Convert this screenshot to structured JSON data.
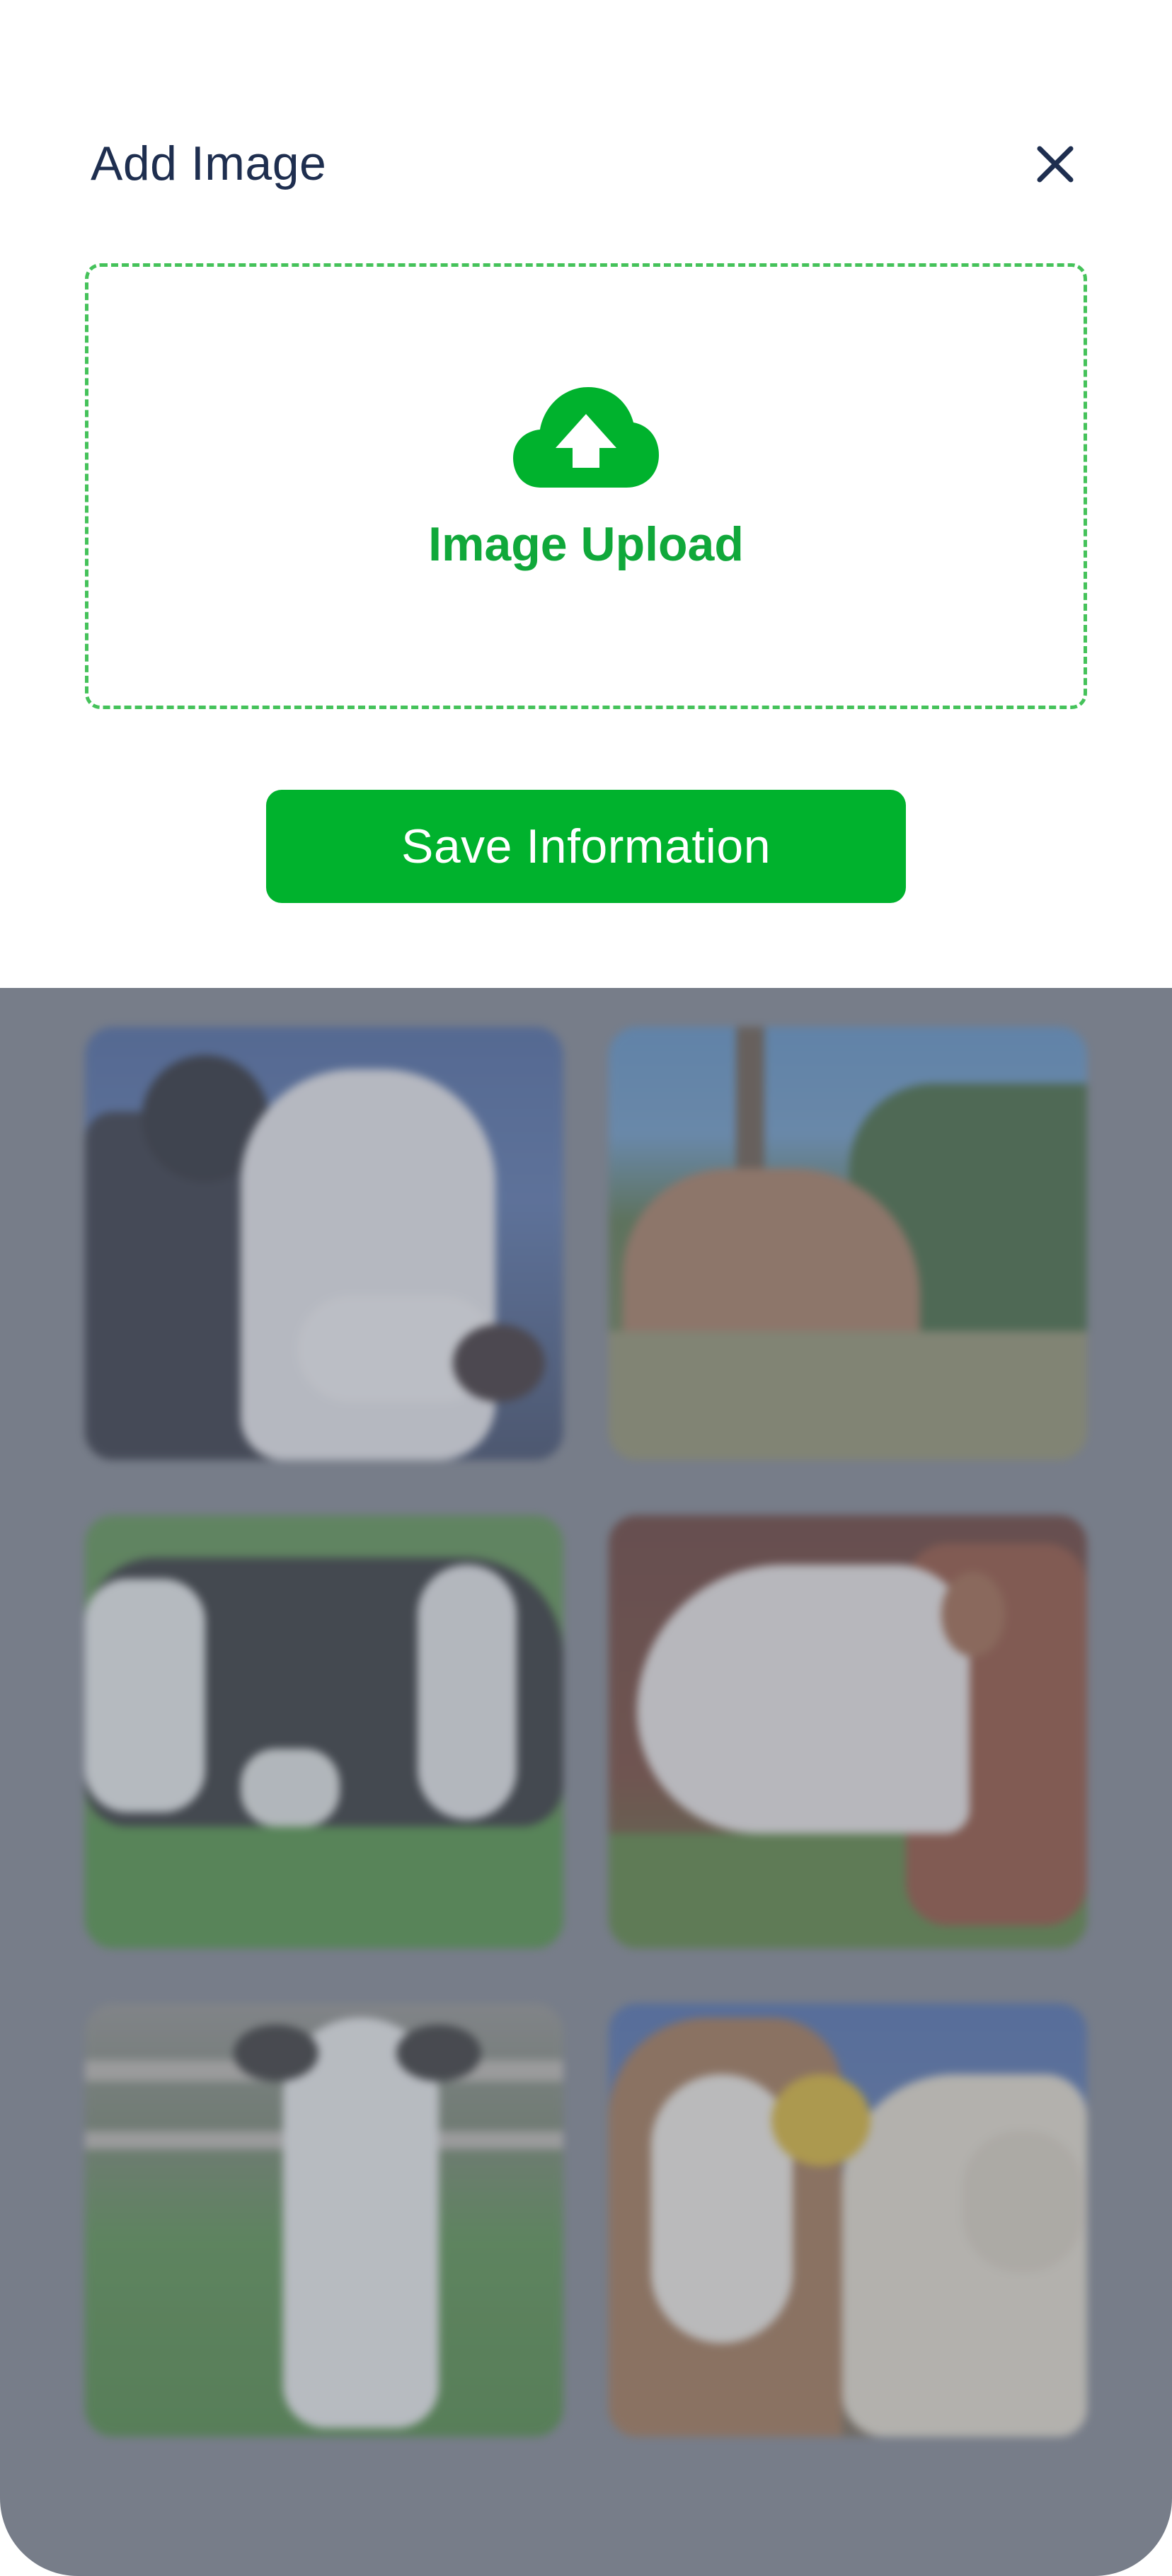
{
  "modal": {
    "title": "Add Image",
    "close_icon": "close-icon",
    "upload": {
      "icon": "cloud-upload-icon",
      "label": "Image Upload"
    },
    "save_label": "Save Information"
  },
  "gallery": {
    "images": [
      {
        "description_icon": "cow-photo"
      },
      {
        "description_icon": "cow-photo"
      },
      {
        "description_icon": "cow-photo"
      },
      {
        "description_icon": "cow-photo"
      },
      {
        "description_icon": "cow-photo"
      },
      {
        "description_icon": "cow-photo"
      }
    ]
  },
  "colors": {
    "accent": "#00b22d",
    "title": "#1e2e4f",
    "dashed_border": "#45c25a",
    "overlay": "#777d89"
  }
}
